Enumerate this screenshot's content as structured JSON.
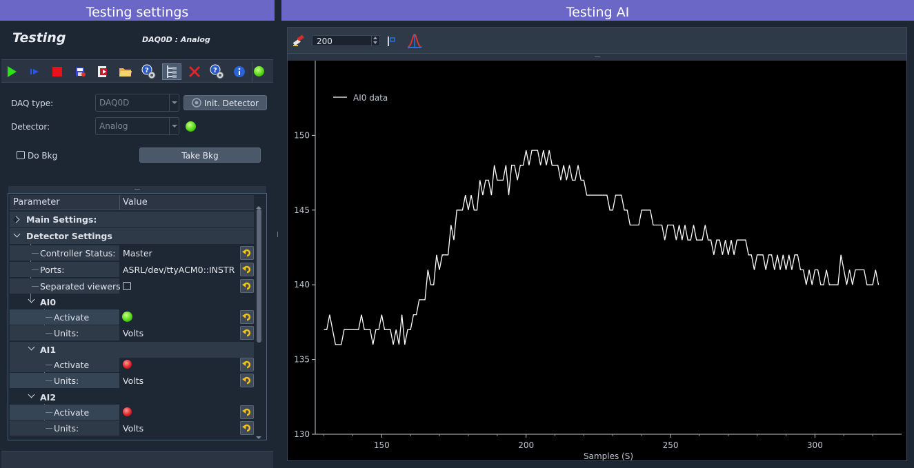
{
  "left_dock": {
    "title": "Testing settings",
    "app_name": "Testing",
    "daq_label": "DAQ0D : Analog",
    "toolbar": {
      "icons": [
        "play-green-icon",
        "step-play-icon",
        "stop-red-icon",
        "save-icon",
        "save-as-icon",
        "open-folder-icon",
        "settings-help-icon",
        "tree-view-icon",
        "close-red-icon",
        "settings-help-icon",
        "info-icon",
        "status-led-icon"
      ]
    },
    "daq_type_label": "DAQ type:",
    "daq_type_value": "DAQ0D",
    "init_detector_label": "Init. Detector",
    "detector_label": "Detector:",
    "detector_value": "Analog",
    "do_bkg_label": "Do Bkg",
    "take_bkg_label": "Take Bkg",
    "tree": {
      "col_parameter": "Parameter",
      "col_value": "Value",
      "main_settings": "Main Settings:",
      "detector_settings": "Detector Settings",
      "controller_status_label": "Controller Status:",
      "controller_status_value": "Master",
      "ports_label": "Ports:",
      "ports_value": "ASRL/dev/ttyACM0::INSTR",
      "separated_viewers_label": "Separated viewers",
      "ai0": "AI0",
      "ai1": "AI1",
      "ai2": "AI2",
      "activate_label": "Activate",
      "units_label": "Units:",
      "units_value": "Volts"
    }
  },
  "right_dock": {
    "title": "Testing AI",
    "spin_value": "200"
  },
  "colors": {
    "title_bar": "#6a67c6",
    "plot_bg": "#000000",
    "trace": "#ffffff",
    "led_green": "#56d81a",
    "led_red": "#e0242a"
  },
  "chart_data": {
    "type": "line",
    "title": "",
    "xlabel": "Samples (S)",
    "ylabel": "",
    "xlim": [
      127,
      330
    ],
    "ylim": [
      130,
      155
    ],
    "xticks": [
      150,
      200,
      250,
      300
    ],
    "yticks": [
      130,
      135,
      140,
      145,
      150
    ],
    "legend": "top-left",
    "series": [
      {
        "name": "AI0 data",
        "x_start": 130,
        "y": [
          137,
          137,
          138,
          137,
          136,
          136,
          136,
          137,
          137,
          137,
          137,
          137,
          137,
          138,
          137,
          137,
          137,
          136,
          137,
          137,
          138,
          137,
          137,
          137,
          136,
          137,
          136,
          138,
          136,
          137,
          137,
          138,
          138,
          139,
          139,
          139,
          141,
          140,
          140,
          142,
          141,
          142,
          142,
          142,
          144,
          143,
          145,
          145,
          145,
          146,
          145,
          146,
          145,
          145,
          147,
          146,
          147,
          147,
          146,
          148,
          147,
          147,
          147,
          148,
          146,
          148,
          148,
          147,
          148,
          148,
          149,
          148,
          149,
          149,
          149,
          148,
          149,
          148,
          149,
          148,
          148,
          148,
          147,
          148,
          147,
          148,
          147,
          147,
          148,
          147,
          147,
          146,
          146,
          146,
          146,
          146,
          146,
          146,
          146,
          145,
          145,
          146,
          146,
          146,
          145,
          145,
          144,
          144,
          144,
          144,
          145,
          145,
          145,
          145,
          144,
          144,
          144,
          144,
          143,
          144,
          144,
          144,
          143,
          144,
          143,
          144,
          143,
          143,
          144,
          143,
          143,
          143,
          144,
          143,
          143,
          142,
          143,
          143,
          142,
          143,
          142,
          143,
          142,
          143,
          143,
          143,
          143,
          142,
          142,
          141,
          142,
          142,
          142,
          141,
          142,
          142,
          141,
          142,
          141,
          142,
          141,
          142,
          141,
          142,
          142,
          141,
          141,
          140,
          141,
          140,
          141,
          141,
          140,
          140,
          141,
          140,
          140,
          140,
          140,
          142,
          141,
          140,
          141,
          140,
          141,
          141,
          141,
          141,
          140,
          140,
          140,
          141,
          140
        ]
      }
    ]
  }
}
